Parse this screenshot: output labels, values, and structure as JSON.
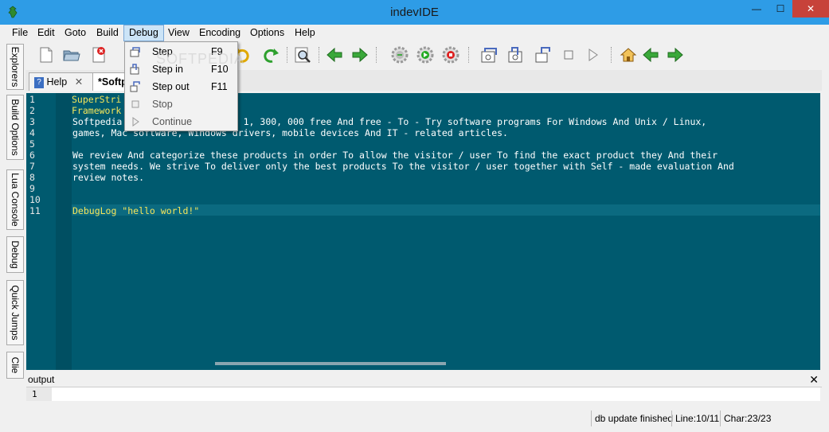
{
  "window": {
    "title": "indevIDE",
    "minimize": "—",
    "maximize": "☐",
    "close": "✕"
  },
  "menu": [
    "File",
    "Edit",
    "Goto",
    "Build",
    "Debug",
    "View",
    "Encoding",
    "Options",
    "Help"
  ],
  "debug_menu": [
    {
      "label": "Step",
      "shortcut": "F9"
    },
    {
      "label": "Step in",
      "shortcut": "F10"
    },
    {
      "label": "Step out",
      "shortcut": "F11"
    },
    {
      "label": "Stop",
      "shortcut": ""
    },
    {
      "label": "Continue",
      "shortcut": ""
    }
  ],
  "side_tabs": [
    "Explorers",
    "Build Options",
    "Lua Console",
    "Debug",
    "Quick Jumps",
    "Clie"
  ],
  "doc_tabs": [
    {
      "label": "Help",
      "close": "✕"
    },
    {
      "label": "*Softp"
    }
  ],
  "editor": {
    "line_numbers": [
      "1",
      "2",
      "3",
      "4",
      "5",
      "6",
      "7",
      "8",
      "9",
      "10",
      "11"
    ],
    "lines": [
      "SuperStri",
      "Framework",
      "Softpedia                    r 1, 300, 000 free And free - To - Try software programs For Windows And Unix / Linux,",
      "games, Mac software, Windows drivers, mobile devices And IT - related articles.",
      "",
      "We review And categorize these products in order To allow the visitor / user To find the exact product they And their",
      "system needs. We strive To deliver only the best products To the visitor / user together with Self - made evaluation And",
      "review notes.",
      "",
      "",
      "DebugLog \"hello world!\""
    ]
  },
  "output": {
    "title": "output",
    "close": "✕",
    "line": "1"
  },
  "status": {
    "message": "db update finished",
    "line": "Line:10/11",
    "char": "Char:23/23"
  },
  "watermark": "SOFTPEDIA",
  "colors": {
    "editor_bg": "#005a6f",
    "keyword": "#f5e55a",
    "number": "#3fe0d0",
    "titlebar": "#2e9ce6"
  }
}
